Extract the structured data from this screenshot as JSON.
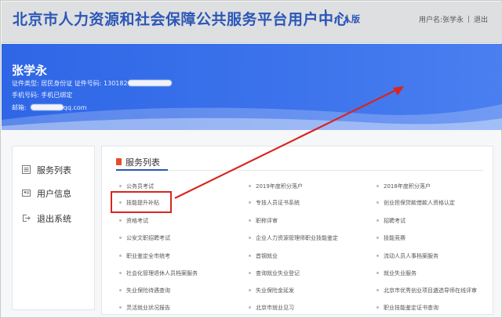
{
  "header": {
    "title": "北京市人力资源和社会保障公共服务平台用户中心",
    "edition": "个人版",
    "user_label": "用户名:张学永",
    "logout": "退出"
  },
  "profile": {
    "name": "张学永",
    "id_line_prefix": "证件类型:  居民身份证    证件号码:  130182",
    "phone_line": "手机号码:      手机已绑定",
    "email_prefix": "邮箱:",
    "email_suffix": "qq.com"
  },
  "nav": {
    "items": [
      {
        "label": "服务列表",
        "icon": "list-icon"
      },
      {
        "label": "用户信息",
        "icon": "user-icon"
      },
      {
        "label": "退出系统",
        "icon": "exit-icon"
      }
    ]
  },
  "services": {
    "title": "服务列表",
    "rows": [
      [
        "公务员考试",
        "2019年度积分落户",
        "2018年度积分落户"
      ],
      [
        "技能提升补贴",
        "专技人员证书系统",
        "创业担保贷款借款人资格认定"
      ],
      [
        "资格考试",
        "职称评审",
        "招聘考试"
      ],
      [
        "公安文职招聘考试",
        "企业人力资源管理师职业技能鉴定",
        "技能竞赛"
      ],
      [
        "职业鉴定全市统考",
        "首钢就业",
        "流动人员人事档案服务"
      ],
      [
        "社会化管理退休人员档案服务",
        "查询就业失业登记",
        "就业失业服务"
      ],
      [
        "失业保险待遇查询",
        "失业保险金延发",
        "北京市优秀创业项目遴选导师在线评审"
      ],
      [
        "灵活就业状况报告",
        "北京市就业见习",
        "职业技能鉴定证书查询"
      ]
    ]
  },
  "annotation": {
    "highlight_color": "#d8261f"
  },
  "colors": {
    "brand_blue": "#2c57b7",
    "banner_blue": "#3d74ec"
  }
}
